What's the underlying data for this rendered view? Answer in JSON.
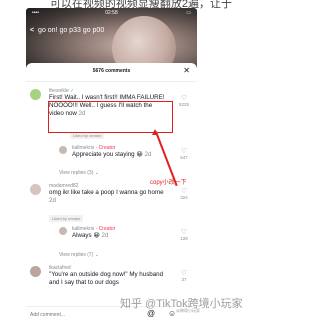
{
  "caption_top": "可以在视频的视频显瘦翻放2遍，让于",
  "status_bar": {
    "carrier": "••••",
    "time": "02:58",
    "battery": "▭"
  },
  "video": {
    "back_glyph": "<",
    "title": "go on! go p33 go p00"
  },
  "sheet": {
    "count_label": "5676 comments",
    "close_glyph": "✕"
  },
  "comments": [
    {
      "username": "thesnikle",
      "verified_glyph": "✓",
      "text": "First! Wait.. I wasn't first!! IMMA FAILURE! NOOOO!!! Well.. I guess I'll watch the video now",
      "time": "2d",
      "likes": "5225",
      "liked_by": "Liked by creator"
    },
    {
      "username": "kallmekris",
      "creator": "· Creator",
      "text": "Appreciate you staying 😀",
      "time": "2d",
      "likes": "547"
    },
    {
      "view_replies": "View replies (3) ⌄"
    },
    {
      "username": "madamred82",
      "text": "omg ikr like take a poop I wanna go home",
      "time": "2d",
      "likes": "324",
      "liked_by": "Liked by creator"
    },
    {
      "username": "kallmekris",
      "creator": "· Creator",
      "text": "Always 😀",
      "time": "2d",
      "likes": "128"
    },
    {
      "view_replies": "View replies (7) ⌄"
    },
    {
      "username": "tkaclafred",
      "text": "\"You're an outside dog now!\" My husband and I say that to our dogs",
      "likes": "37"
    }
  ],
  "heart_glyph": "♡",
  "annotation": {
    "text": "copy小改一下"
  },
  "composer": {
    "placeholder": "Add comment...",
    "at_glyph": "@",
    "emoji_glyph": "☺"
  },
  "watermark": {
    "text": "知乎 @TikTok跨境小玩家",
    "small": "@跨境小玩家"
  },
  "colors": {
    "accent": "#fe2c55",
    "annotation": "#e02020",
    "verified": "#20d5ec"
  }
}
